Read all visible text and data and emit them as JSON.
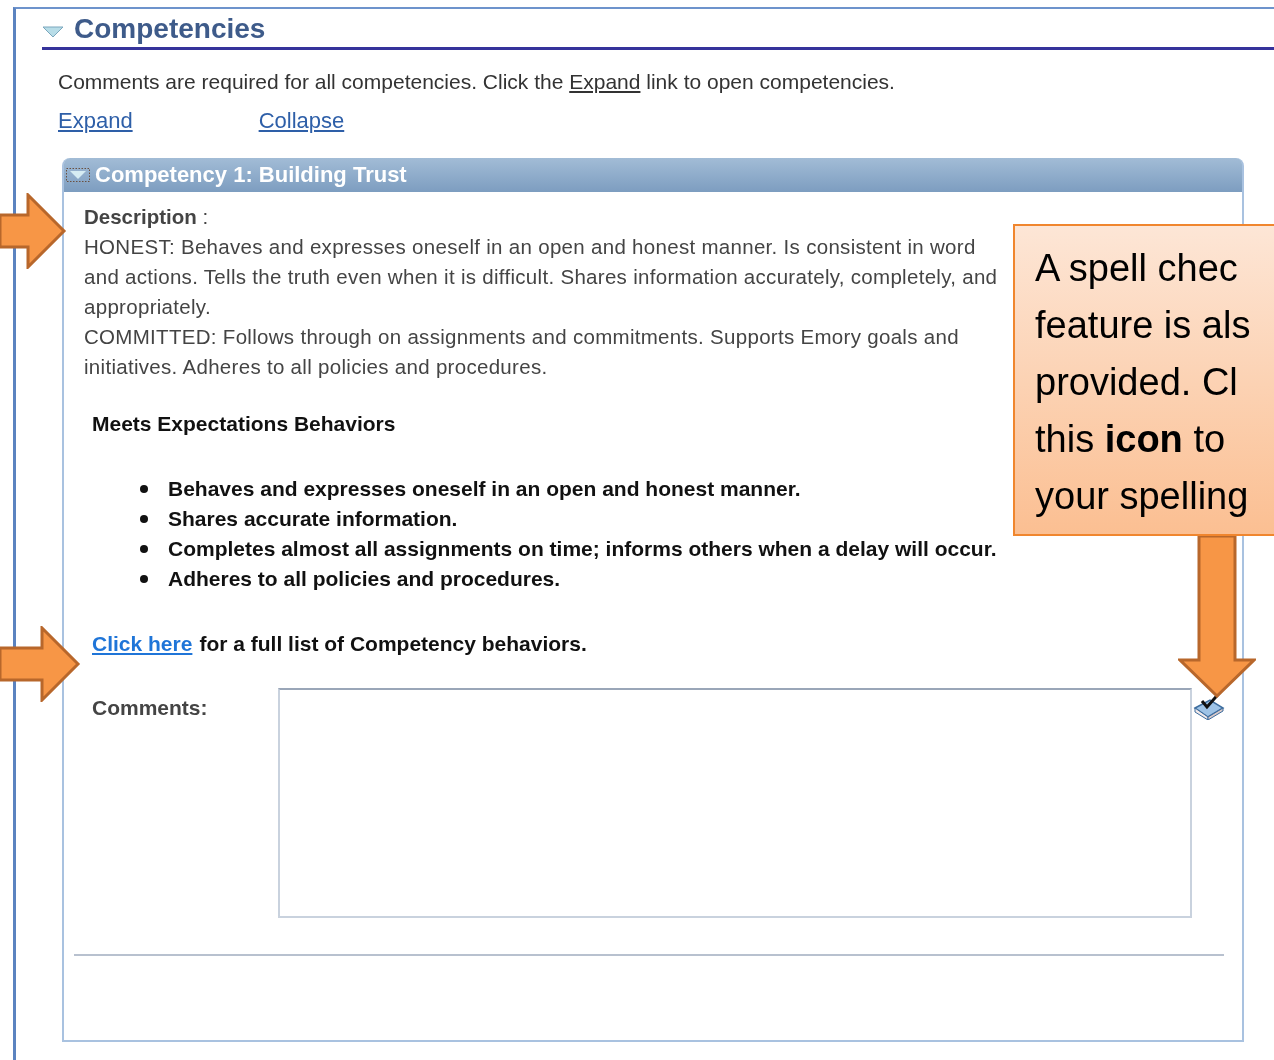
{
  "section": {
    "title": "Competencies",
    "expanded": true
  },
  "instructions": {
    "before": "Comments are required for all competencies. Click the ",
    "link": "Expand",
    "after": " link to open competencies."
  },
  "links": [
    "Expand",
    "Collapse"
  ],
  "panel": {
    "title": "Competency 1: Building Trust",
    "expanded": true,
    "description_label": "Description",
    "description_colon": ":",
    "description": [
      "HONEST: Behaves and expresses oneself in an open and honest manner. Is consistent in word and actions. Tells the truth even when it is difficult. Shares information accurately, completely, and appropriately.",
      "COMMITTED: Follows through on assignments and commitments. Supports Emory goals and initiatives. Adheres to all policies and procedures."
    ],
    "behaviors_heading": "Meets Expectations Behaviors",
    "behaviors": [
      "Behaves and expresses oneself in an open and honest manner.",
      "Shares accurate information.",
      "Completes almost all assignments on time; informs others when a delay will occur.",
      "Adheres to all policies and procedures."
    ],
    "more_link": "Click here",
    "more_text": "for a full list of Competency behaviors.",
    "comments_label": "Comments:"
  },
  "callout": {
    "lines": [
      "A spell chec",
      "feature is als",
      "provided.  Cl",
      "this **icon** to",
      "your spelling"
    ]
  }
}
